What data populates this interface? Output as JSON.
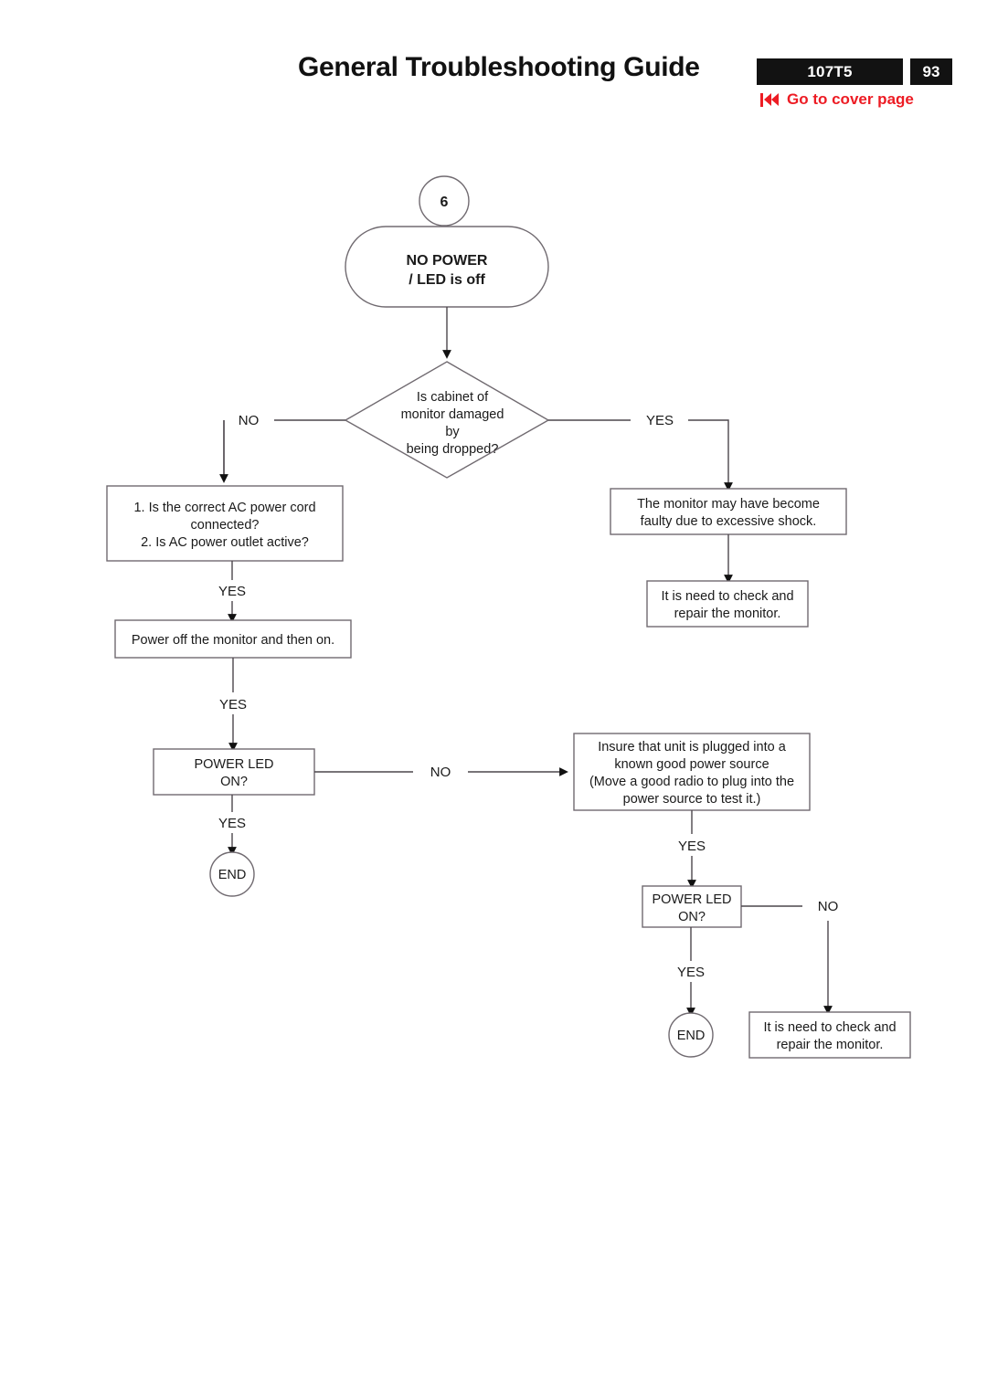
{
  "header": {
    "title": "General Troubleshooting Guide",
    "model_badge": "107T5",
    "page_number": "93",
    "cover_link": "Go to cover page",
    "cover_link_icon": "skip-back-icon",
    "accent_color": "#ed1c24",
    "badge_color": "#121212"
  },
  "flowchart": {
    "type": "flowchart",
    "connector_label_start": "6",
    "nodes": {
      "start_connector": "6",
      "terminal_title": "NO POWER",
      "terminal_subtitle": "/ LED is off",
      "decision_damage": {
        "line1": "Is cabinet of",
        "line2": "monitor damaged",
        "line3": "by",
        "line4": "being dropped?"
      },
      "check_power_cord": {
        "line1": "1. Is the correct AC power cord",
        "line2": "connected?",
        "line3": "2. Is AC power outlet active?"
      },
      "power_cycle": "Power off the monitor and then on.",
      "power_led_1": {
        "line1": "POWER LED",
        "line2": "ON?"
      },
      "end_1": "END",
      "faulty_shock": {
        "line1": "The monitor may have become",
        "line2": "faulty due to excessive shock."
      },
      "need_repair_1": {
        "line1": "It is need to check and",
        "line2": "repair the monitor."
      },
      "insure_plugged": {
        "line1": "Insure that unit is plugged into a",
        "line2": "known good power source",
        "line3": "(Move a good radio to plug into the",
        "line4": "power source to test it.)"
      },
      "power_led_2": {
        "line1": "POWER LED",
        "line2": "ON?"
      },
      "end_2": "END",
      "need_repair_2": {
        "line1": "It is need to check and",
        "line2": "repair the monitor."
      }
    },
    "edge_labels": {
      "decision_no": "NO",
      "decision_yes": "YES",
      "cord_yes": "YES",
      "cycle_yes": "YES",
      "led1_no": "NO",
      "led1_yes": "YES",
      "insure_yes": "YES",
      "led2_no": "NO",
      "led2_yes": "YES"
    }
  }
}
